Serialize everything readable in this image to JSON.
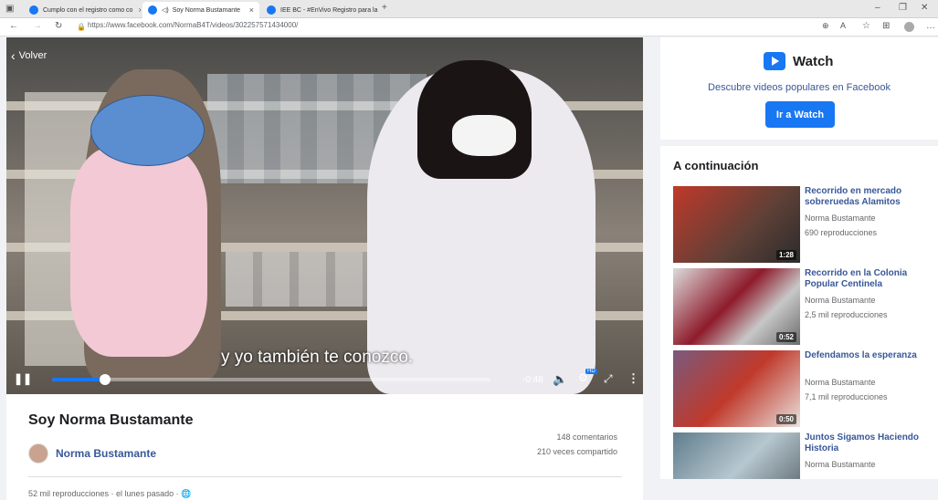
{
  "browser": {
    "tabs": [
      {
        "label": "Cumplo con el registro como co"
      },
      {
        "label": "Soy Norma Bustamante"
      },
      {
        "label": "IEE BC - #EnVivo Registro para la"
      }
    ],
    "url": "https://www.facebook.com/NormaB4T/videos/302257571434000/",
    "new_tab": "+",
    "close": "×"
  },
  "video": {
    "back_label": "Volver",
    "caption": "y yo también te conozco.",
    "time_remaining": "-0:48",
    "hd_badge": "HD",
    "progress": 0.12,
    "colors": {
      "accent": "#1877f2"
    }
  },
  "post": {
    "title": "Soy Norma Bustamante",
    "author": "Norma Bustamante",
    "comments": "148 comentarios",
    "shares": "210 veces compartido",
    "views": "52 mil reproducciones · el lunes pasado ·"
  },
  "watch": {
    "title": "Watch",
    "description": "Descubre videos populares en Facebook",
    "button": "Ir a Watch"
  },
  "upnext": {
    "heading": "A continuación",
    "items": [
      {
        "title": "Recorrido en mercado sobreruedas Alamitos",
        "channel": "Norma Bustamante",
        "views": "690 reproducciones",
        "duration": "1:28"
      },
      {
        "title": "Recorrido en la Colonia Popular Centinela",
        "channel": "Norma Bustamante",
        "views": "2,5 mil reproducciones",
        "duration": "0:52"
      },
      {
        "title": "Defendamos la esperanza",
        "channel": "Norma Bustamante",
        "views": "7,1 mil reproducciones",
        "duration": "0:50"
      },
      {
        "title": "Juntos Sigamos Haciendo Historia",
        "channel": "Norma Bustamante",
        "views": "",
        "duration": ""
      }
    ]
  }
}
